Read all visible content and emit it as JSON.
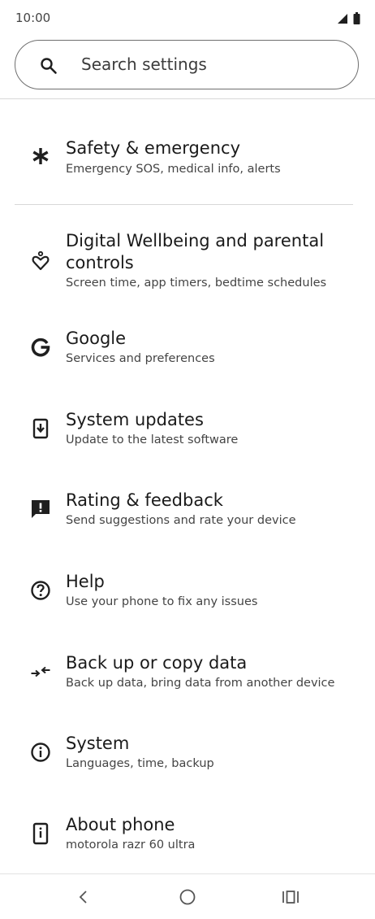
{
  "status_bar": {
    "time": "10:00"
  },
  "search": {
    "placeholder": "Search settings",
    "icon": "search-icon"
  },
  "items": [
    {
      "title": "Safety & emergency",
      "subtitle": "Emergency SOS, medical info, alerts",
      "icon": "asterisk-icon"
    },
    {
      "title": "Digital Wellbeing and parental controls",
      "subtitle": "Screen time, app timers, bedtime schedules",
      "icon": "wellbeing-heart-icon"
    },
    {
      "title": "Google",
      "subtitle": "Services and preferences",
      "icon": "google-g-icon"
    },
    {
      "title": "System updates",
      "subtitle": "Update to the latest software",
      "icon": "system-update-icon"
    },
    {
      "title": "Rating & feedback",
      "subtitle": "Send suggestions and rate your device",
      "icon": "feedback-icon"
    },
    {
      "title": "Help",
      "subtitle": "Use your phone to fix any issues",
      "icon": "help-icon"
    },
    {
      "title": "Back up or copy data",
      "subtitle": "Back up data, bring data from another device",
      "icon": "backup-arrows-icon"
    },
    {
      "title": "System",
      "subtitle": "Languages, time, backup",
      "icon": "info-icon"
    },
    {
      "title": "About phone",
      "subtitle": "motorola razr 60 ultra",
      "icon": "phone-info-icon"
    }
  ],
  "nav": {
    "buttons": [
      "back-icon",
      "home-icon",
      "recents-icon"
    ]
  }
}
